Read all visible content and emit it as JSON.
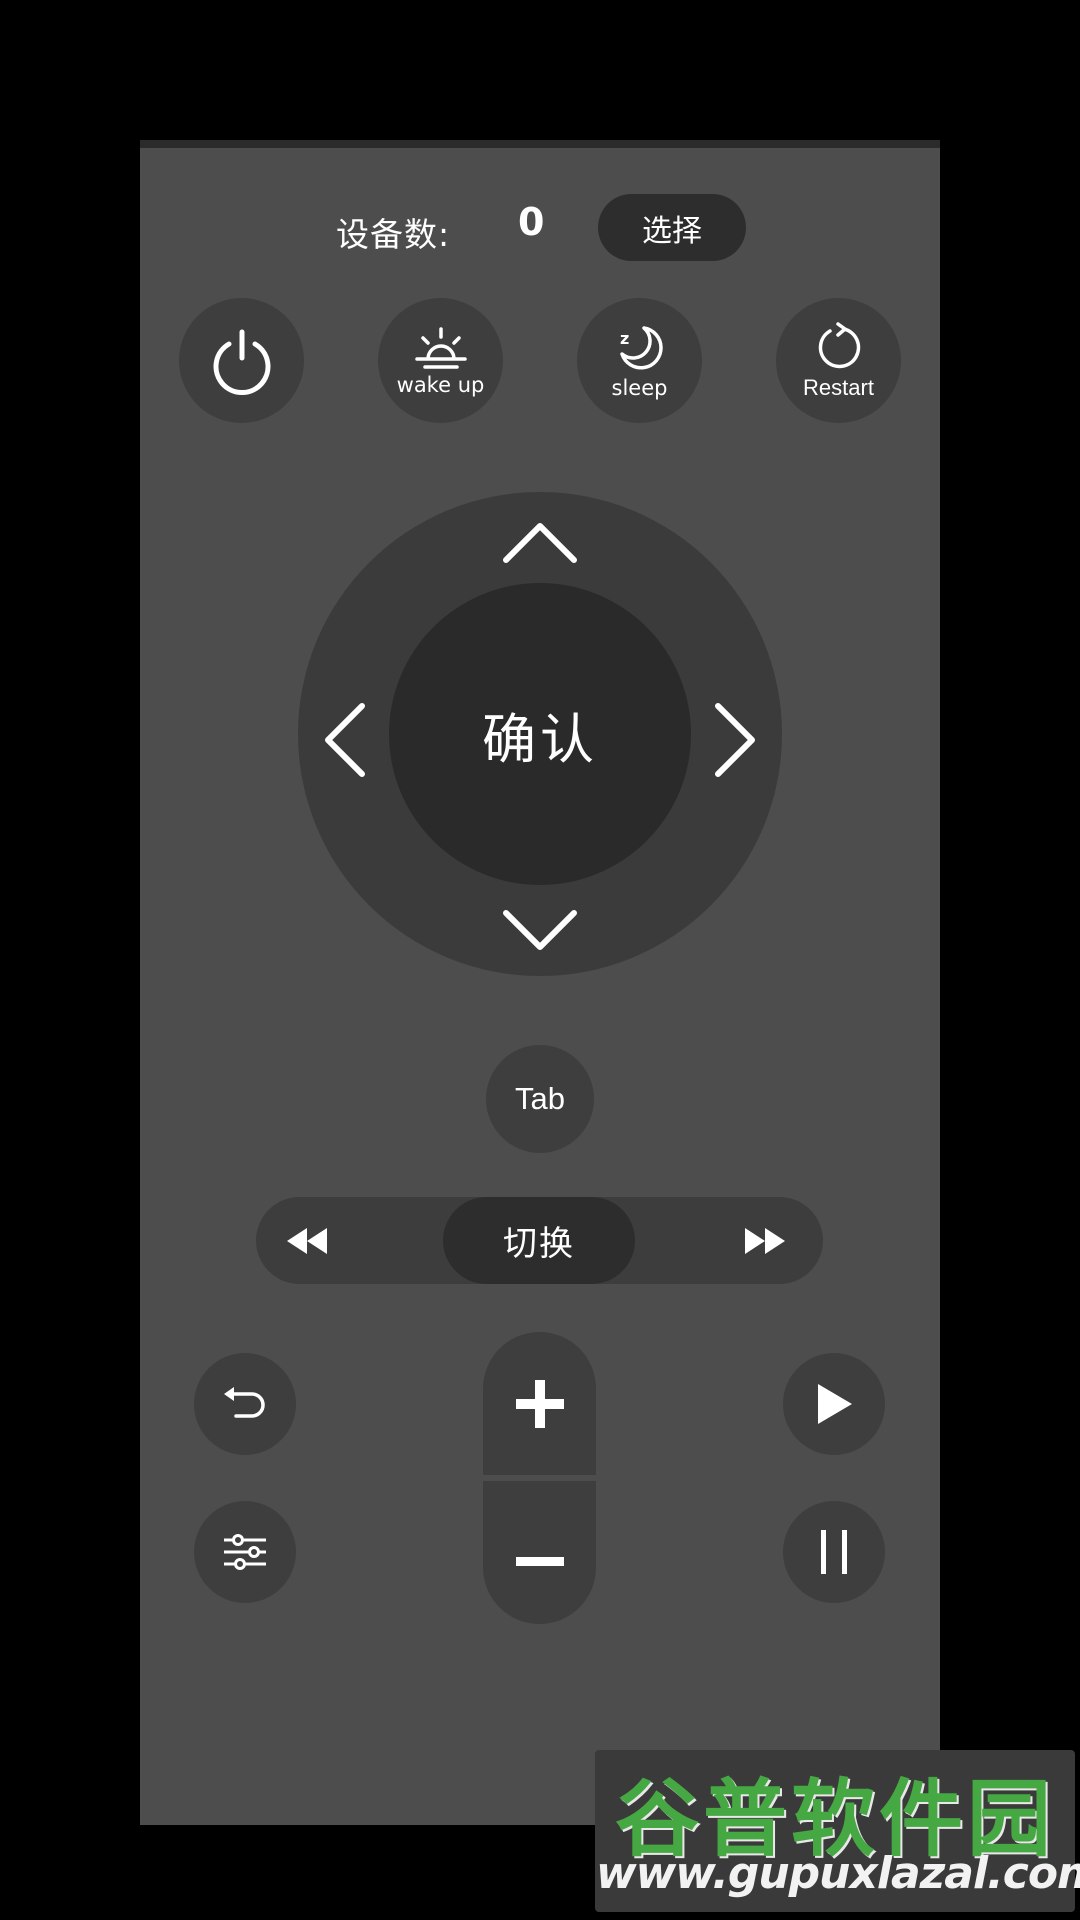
{
  "header": {
    "device_count_label": "设备数:",
    "device_count_value": "0",
    "select_label": "选择"
  },
  "power_row": {
    "power_icon": "power-icon",
    "wake": {
      "icon": "sunrise-icon",
      "label": "wake up"
    },
    "sleep": {
      "icon": "moon-sleep-icon",
      "label": "sleep"
    },
    "restart": {
      "icon": "restart-icon",
      "label": "Restart"
    }
  },
  "dpad": {
    "ok_label": "确认",
    "up_icon": "chevron-up-icon",
    "down_icon": "chevron-down-icon",
    "left_icon": "chevron-left-icon",
    "right_icon": "chevron-right-icon"
  },
  "tab_label": "Tab",
  "switch_bar": {
    "rewind_icon": "rewind-icon",
    "switch_label": "切换",
    "fast_forward_icon": "fast-forward-icon"
  },
  "controls": {
    "back_icon": "back-icon",
    "settings_icon": "sliders-icon",
    "volume_up_icon": "plus-icon",
    "volume_down_icon": "minus-icon",
    "play_icon": "play-icon",
    "pause_icon": "pause-icon"
  },
  "watermark": {
    "title": "谷普软件园",
    "url": "www.gupuxlazal.com"
  },
  "colors": {
    "background": "#000000",
    "panel": "#4d4d4d",
    "button": "#3e3e3e",
    "button_dark": "#2a2a2a",
    "text": "#ffffff",
    "watermark_green": "#46a843"
  }
}
